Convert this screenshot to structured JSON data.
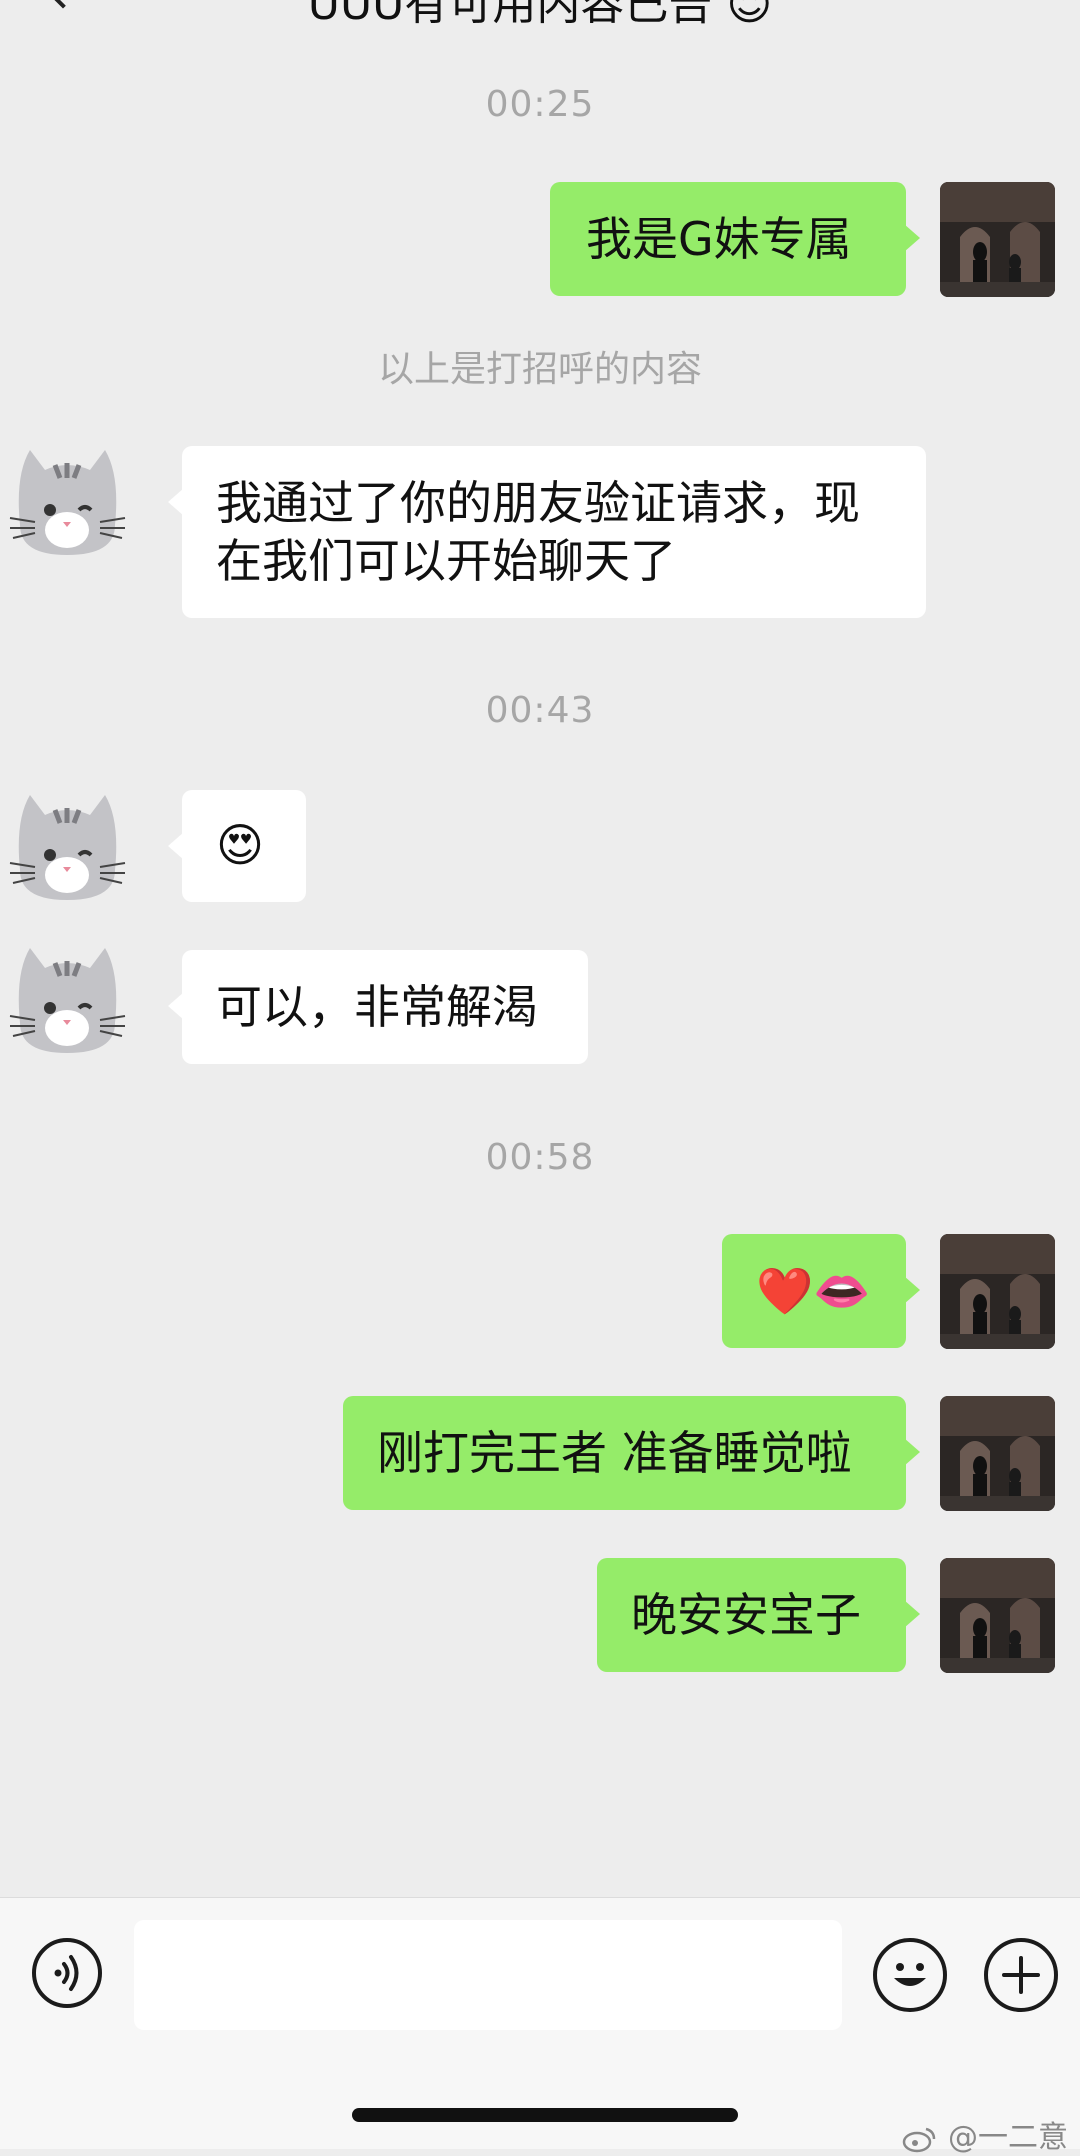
{
  "header": {
    "title": "UUU有可用内容已告 ☺"
  },
  "messages": {
    "ts1": "00:25",
    "m1": "我是G妹专属",
    "system_note": "以上是打招呼的内容",
    "m2_line1": "我通过了你的朋友验证请求，现",
    "m2_line2": "在我们可以开始聊天了",
    "ts2": "00:43",
    "m3": "😍",
    "m4": "可以，非常解渴",
    "ts3": "00:58",
    "m5": "❤️👄",
    "m6": "刚打完王者 准备睡觉啦",
    "m7": "晚安安宝子"
  },
  "input_bar": {
    "value": "",
    "voice_icon": "voice-icon",
    "emoji_icon": "emoji-icon",
    "plus_icon": "plus-icon"
  },
  "watermark": "@一二意",
  "colors": {
    "background": "#ededed",
    "outgoing_bubble": "#95ec69",
    "incoming_bubble": "#ffffff",
    "timestamp_text": "#a6a6a6"
  }
}
